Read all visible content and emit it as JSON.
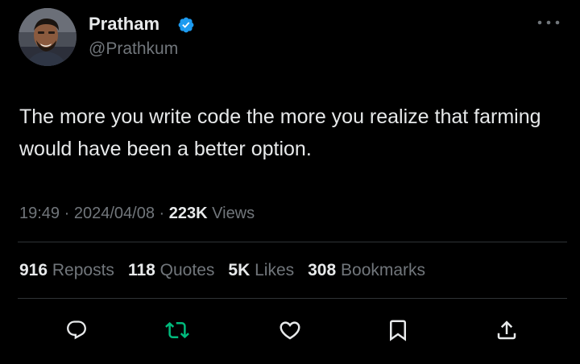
{
  "author": {
    "display_name": "Pratham",
    "handle": "@Prathkum",
    "verified_icon": "verified-badge-icon",
    "avatar_icon": "profile-photo"
  },
  "tweet": {
    "text": "The more you write code the more you realize that farming would have been a better option.",
    "time": "19:49",
    "separator": "·",
    "date": "2024/04/08",
    "views_count": "223K",
    "views_label": "Views"
  },
  "stats": [
    {
      "count": "916",
      "label": "Reposts"
    },
    {
      "count": "118",
      "label": "Quotes"
    },
    {
      "count": "5K",
      "label": "Likes"
    },
    {
      "count": "308",
      "label": "Bookmarks"
    }
  ],
  "actions": [
    "reply-icon",
    "repost-icon",
    "like-icon",
    "bookmark-icon",
    "share-icon"
  ],
  "colors": {
    "background": "#000000",
    "primary_text": "#e7e9ea",
    "secondary_text": "#71767b",
    "verified_blue": "#1d9bf0",
    "repost_green": "#00ba7c",
    "divider": "#2f3336"
  }
}
